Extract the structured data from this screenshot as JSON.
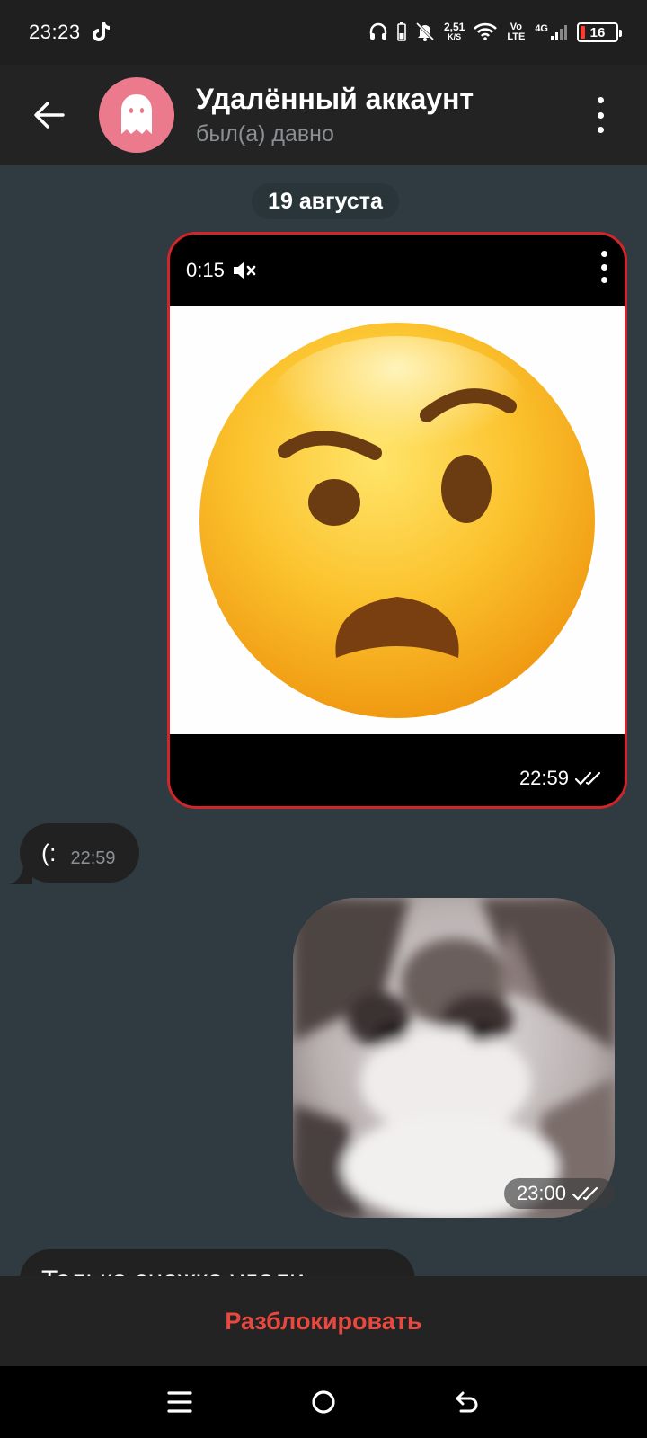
{
  "status_bar": {
    "time": "23:23",
    "net_speed_value": "2,51",
    "net_speed_unit": "K/S",
    "volte": "Vo LTE",
    "network": "4G",
    "battery": "16",
    "colors": {
      "battery_low": "#ff3b30"
    }
  },
  "header": {
    "title": "Удалённый аккаунт",
    "subtitle": "был(а) давно",
    "back_icon": "arrow-left-icon",
    "avatar_icon": "ghost-icon",
    "menu_icon": "more-vertical-icon",
    "colors": {
      "avatar_bg": "#ea7a8c"
    }
  },
  "chat": {
    "date_chip": "19 августа",
    "messages": [
      {
        "type": "video",
        "direction": "out",
        "duration": "0:15",
        "muted": true,
        "time": "22:59",
        "status": "read"
      },
      {
        "type": "text",
        "direction": "in",
        "text": "(:",
        "time": "22:59"
      },
      {
        "type": "sticker",
        "direction": "out",
        "time": "23:00",
        "status": "read"
      },
      {
        "type": "text",
        "direction": "in",
        "text": "Только снежка удали"
      }
    ]
  },
  "bottom": {
    "action_label": "Разблокировать",
    "colors": {
      "action": "#e8483f"
    }
  },
  "nav": {
    "items": [
      "menu-icon",
      "home-circle-icon",
      "back-icon"
    ]
  }
}
